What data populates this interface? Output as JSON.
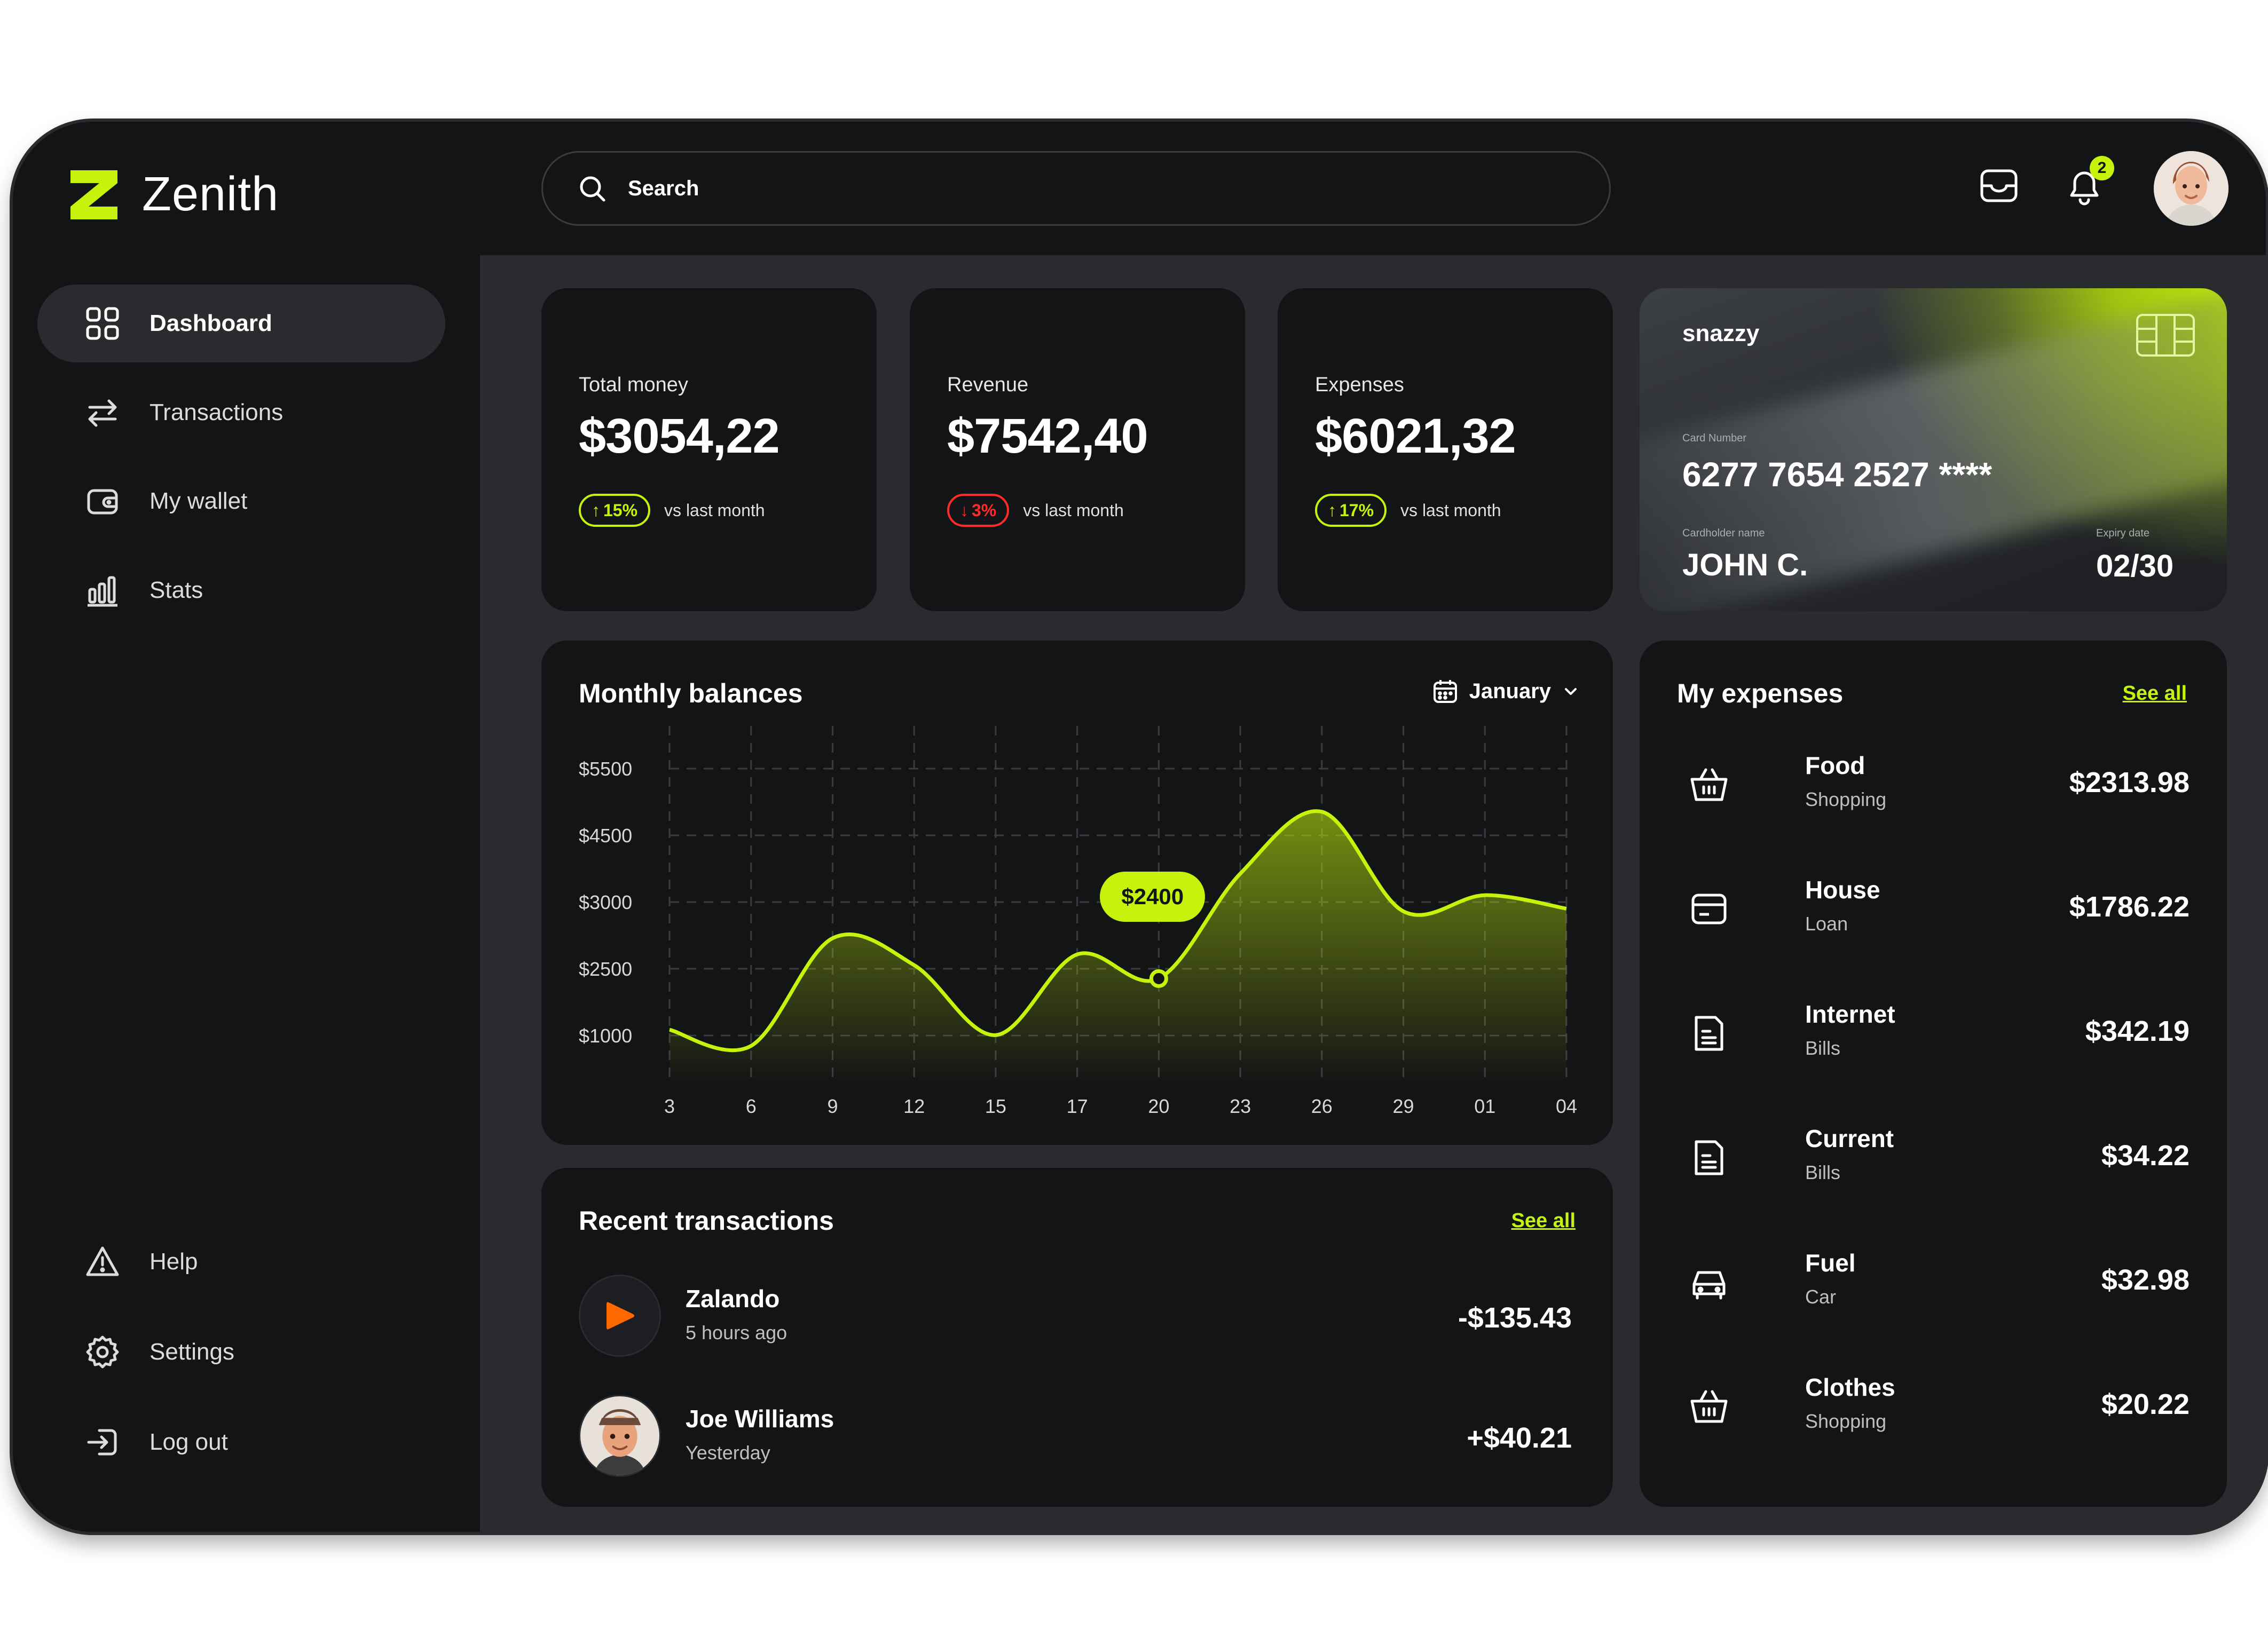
{
  "app": {
    "name": "Zenith"
  },
  "sidebar": {
    "items": [
      {
        "label": "Dashboard",
        "icon": "dashboard-grid-icon",
        "active": true
      },
      {
        "label": "Transactions",
        "icon": "transfer-arrows-icon"
      },
      {
        "label": "My wallet",
        "icon": "wallet-icon"
      },
      {
        "label": "Stats",
        "icon": "bar-chart-icon"
      }
    ],
    "bottom_items": [
      {
        "label": "Help",
        "icon": "warning-triangle-icon"
      },
      {
        "label": "Settings",
        "icon": "gear-icon"
      },
      {
        "label": "Log out",
        "icon": "logout-icon"
      }
    ]
  },
  "topbar": {
    "search_placeholder": "Search",
    "notification_count": "2",
    "icons": [
      "inbox-icon",
      "bell-icon",
      "avatar"
    ]
  },
  "stats": [
    {
      "label": "Total money",
      "value": "$3054,22",
      "change": "15%",
      "direction": "up",
      "note": "vs last month"
    },
    {
      "label": "Revenue",
      "value": "$7542,40",
      "change": "3%",
      "direction": "down",
      "note": "vs last month"
    },
    {
      "label": "Expenses",
      "value": "$6021,32",
      "change": "17%",
      "direction": "up",
      "note": "vs last month"
    }
  ],
  "credit_card": {
    "brand": "snazzy",
    "number_label": "Card Number",
    "number": "6277 7654 2527 ****",
    "holder_label": "Cardholder name",
    "holder": "JOHN C.",
    "expiry_label": "Expiry date",
    "expiry": "02/30"
  },
  "monthly_balances": {
    "title": "Monthly balances",
    "month": "January",
    "tooltip": "$2400"
  },
  "chart_data": {
    "type": "area",
    "title": "Monthly balances",
    "y_tick_labels": [
      "$5500",
      "$4500",
      "$3000",
      "$2500",
      "$1000"
    ],
    "x": [
      "3",
      "6",
      "9",
      "12",
      "15",
      "17",
      "20",
      "23",
      "26",
      "29",
      "01",
      "04"
    ],
    "series": [
      {
        "values": [
          1000,
          700,
          2700,
          2200,
          900,
          2400,
          1950,
          3900,
          5050,
          3200,
          3500,
          3250
        ]
      }
    ],
    "highlight": {
      "x": "20",
      "label": "$2400"
    },
    "grid": true,
    "accent_color": "#c6f20b"
  },
  "recent_transactions": {
    "title": "Recent transactions",
    "see_all": "See all",
    "items": [
      {
        "name": "Zalando",
        "time": "5 hours ago",
        "amount": "-$135.43",
        "icon": "play-logo-icon"
      },
      {
        "name": "Joe Williams",
        "time": "Yesterday",
        "amount": "+$40.21",
        "icon": "avatar"
      }
    ]
  },
  "my_expenses": {
    "title": "My expenses",
    "see_all": "See all",
    "items": [
      {
        "name": "Food",
        "category": "Shopping",
        "amount": "$2313.98",
        "icon": "basket-icon"
      },
      {
        "name": "House",
        "category": "Loan",
        "amount": "$1786.22",
        "icon": "card-icon"
      },
      {
        "name": "Internet",
        "category": "Bills",
        "amount": "$342.19",
        "icon": "bill-icon"
      },
      {
        "name": "Current",
        "category": "Bills",
        "amount": "$34.22",
        "icon": "bill-icon"
      },
      {
        "name": "Fuel",
        "category": "Car",
        "amount": "$32.98",
        "icon": "car-icon"
      },
      {
        "name": "Clothes",
        "category": "Shopping",
        "amount": "$20.22",
        "icon": "basket-icon"
      }
    ]
  },
  "colors": {
    "accent": "#c6f20b",
    "down": "#ff2a2a",
    "panel": "#131416",
    "background": "#2a2b2e"
  }
}
